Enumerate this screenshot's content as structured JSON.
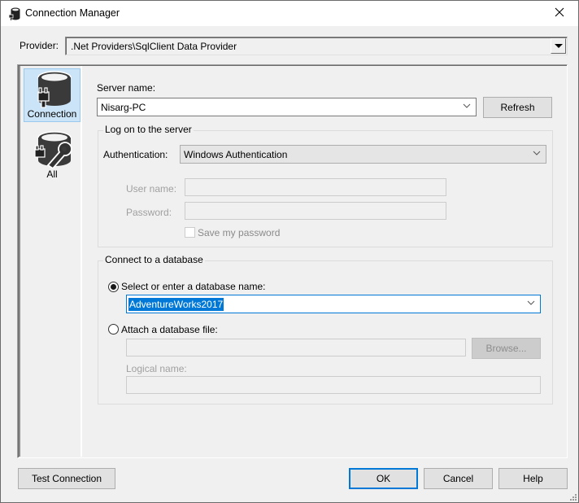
{
  "window": {
    "title": "Connection Manager",
    "title_icon": "database-icon",
    "close_icon": "close-icon"
  },
  "provider": {
    "label": "Provider:",
    "value": ".Net Providers\\SqlClient Data Provider"
  },
  "nav": {
    "items": [
      {
        "label": "Connection",
        "icon": "database-plug-icon",
        "selected": true
      },
      {
        "label": "All",
        "icon": "database-plug-wrench-icon",
        "selected": false
      }
    ]
  },
  "server": {
    "label": "Server name:",
    "value": "Nisarg-PC",
    "refresh_label": "Refresh"
  },
  "logon": {
    "group_title": "Log on to the server",
    "auth_label": "Authentication:",
    "auth_value": "Windows Authentication",
    "username_label": "User name:",
    "username_value": "",
    "password_label": "Password:",
    "password_value": "",
    "save_password_label": "Save my password",
    "save_password_checked": false
  },
  "database": {
    "group_title": "Connect to a database",
    "select_radio_label": "Select or enter a database name:",
    "select_radio_checked": true,
    "database_name": "AdventureWorks2017",
    "attach_radio_label": "Attach a database file:",
    "attach_radio_checked": false,
    "attach_file_value": "",
    "browse_label": "Browse...",
    "logical_name_label": "Logical name:",
    "logical_name_value": ""
  },
  "footer": {
    "test_connection_label": "Test Connection",
    "ok_label": "OK",
    "cancel_label": "Cancel",
    "help_label": "Help"
  },
  "colors": {
    "accent": "#0078d7",
    "nav_selected_bg": "#cce4f7",
    "window_bg": "#f0f0f0"
  }
}
